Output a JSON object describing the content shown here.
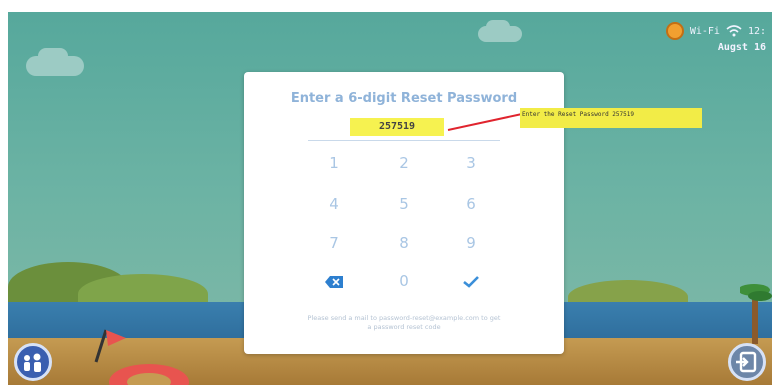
{
  "dialog": {
    "title": "Enter a 6-digit Reset Password",
    "password_value": "257519",
    "keypad": [
      "1",
      "2",
      "3",
      "4",
      "5",
      "6",
      "7",
      "8",
      "9"
    ],
    "zero": "0",
    "backspace_icon": "backspace-icon",
    "confirm_icon": "checkmark-icon",
    "footer_line1": "Please send a mail to password-reset@example.com to get",
    "footer_line2": "a password reset code"
  },
  "annotation": {
    "text": "Enter the Reset Password 257519",
    "color": "#f2ec47",
    "arrow_color": "#e0242e"
  },
  "status": {
    "wifi_text": "Wi-Fi",
    "time": "12:",
    "date": "Augst 16"
  },
  "colors": {
    "sky": "#5ea99f",
    "sea": "#2e6d9c",
    "sand": "#b88a44",
    "accent_blue": "#a9c6e4",
    "check_blue": "#3b8fd9"
  },
  "icons": {
    "left_button": "family-icon",
    "right_button": "exit-icon"
  }
}
